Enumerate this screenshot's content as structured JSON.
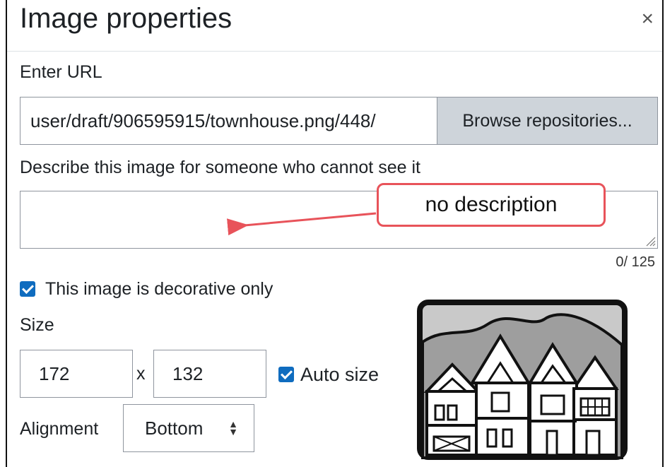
{
  "dialog": {
    "title": "Image properties",
    "close_glyph": "×"
  },
  "url": {
    "label": "Enter URL",
    "value": "/448/user/draft/906595915/townhouse.png",
    "browse_label": "Browse repositories..."
  },
  "description": {
    "label": "Describe this image for someone who cannot see it",
    "value": "",
    "counter": "0/ 125"
  },
  "annotation": {
    "text": "no description",
    "color": "#e8535a"
  },
  "decorative": {
    "label": "This image is decorative only",
    "checked": true
  },
  "size": {
    "label": "Size",
    "width": "172",
    "separator": "x",
    "height": "132",
    "auto_label": "Auto size",
    "auto_checked": true
  },
  "alignment": {
    "label": "Alignment",
    "selected": "Bottom"
  },
  "preview": {
    "icon": "townhouse-image"
  },
  "colors": {
    "accent": "#0f6cbf",
    "button_bg": "#ced4da"
  }
}
